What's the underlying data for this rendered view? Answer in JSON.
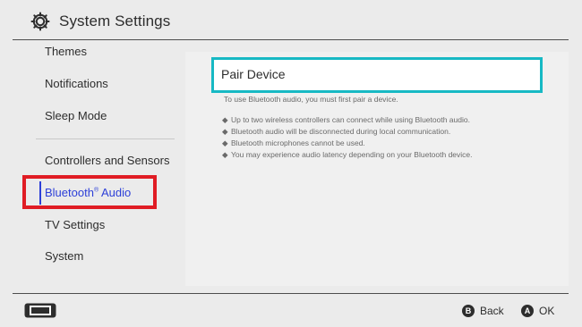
{
  "header": {
    "title": "System Settings",
    "icon": "gear-icon"
  },
  "sidebar": {
    "items": [
      {
        "label": "Themes"
      },
      {
        "label": "Notifications"
      },
      {
        "label": "Sleep Mode"
      },
      {
        "label": "Controllers and Sensors"
      },
      {
        "label_main": "Bluetooth",
        "label_reg": "®",
        "label_tail": " Audio",
        "selected": true
      },
      {
        "label": "TV Settings"
      },
      {
        "label": "System"
      }
    ]
  },
  "main": {
    "pair_device_label": "Pair Device",
    "description": "To use Bluetooth audio, you must first pair a device.",
    "bullet_glyph": "◆",
    "bullets": [
      "Up to two wireless controllers can connect while using Bluetooth audio.",
      "Bluetooth audio will be disconnected during local communication.",
      "Bluetooth microphones cannot be used.",
      "You may experience audio latency depending on your Bluetooth device."
    ]
  },
  "footer": {
    "back": {
      "glyph": "B",
      "label": "Back"
    },
    "ok": {
      "glyph": "A",
      "label": "OK"
    }
  },
  "colors": {
    "accent_selected": "#2c3fd8",
    "focus_border": "#17b9c4",
    "annotation_red": "#e01c24"
  }
}
